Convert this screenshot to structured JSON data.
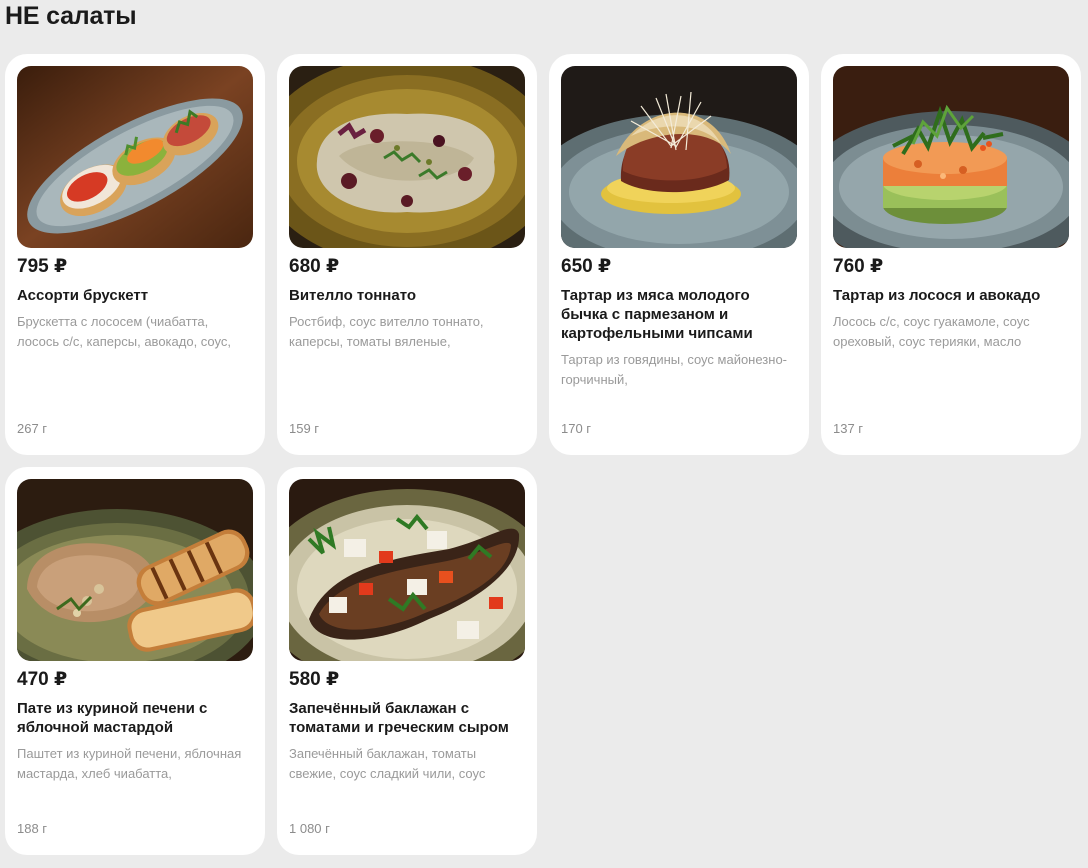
{
  "section": {
    "title": "НЕ салаты"
  },
  "items": [
    {
      "price": "795 ₽",
      "name": "Ассорти брускетт",
      "description": "Брускетта с лососем (чиабатта, лосось с/с, каперсы, авокадо, соус,",
      "weight": "267 г",
      "image": "bruschetta-photo"
    },
    {
      "price": "680 ₽",
      "name": "Вителло тоннато",
      "description": "Ростбиф, соус вителло тоннато, каперсы, томаты вяленые,",
      "weight": "159 г",
      "image": "vitello-tonnato-photo"
    },
    {
      "price": "650 ₽",
      "name": "Тартар из мяса молодого бычка с пармезаном и картофельными чипсами",
      "description": "Тартар из говядины, соус майонезно-горчичный,",
      "weight": "170 г",
      "image": "beef-tartare-photo"
    },
    {
      "price": "760 ₽",
      "name": "Тартар из лосося и авокадо",
      "description": "Лосось с/с, соус гуакамоле, соус ореховый, соус терияки, масло",
      "weight": "137 г",
      "image": "salmon-tartare-photo"
    },
    {
      "price": "470 ₽",
      "name": "Пате из куриной печени с яблочной мастардой",
      "description": "Паштет из куриной печени, яблочная мастарда, хлеб чиабатта,",
      "weight": "188 г",
      "image": "liver-pate-photo"
    },
    {
      "price": "580 ₽",
      "name": "Запечённый баклажан с томатами и греческим сыром",
      "description": "Запечённый баклажан, томаты свежие, соус сладкий чили, соус",
      "weight": "1 080 г",
      "image": "baked-eggplant-photo"
    }
  ]
}
